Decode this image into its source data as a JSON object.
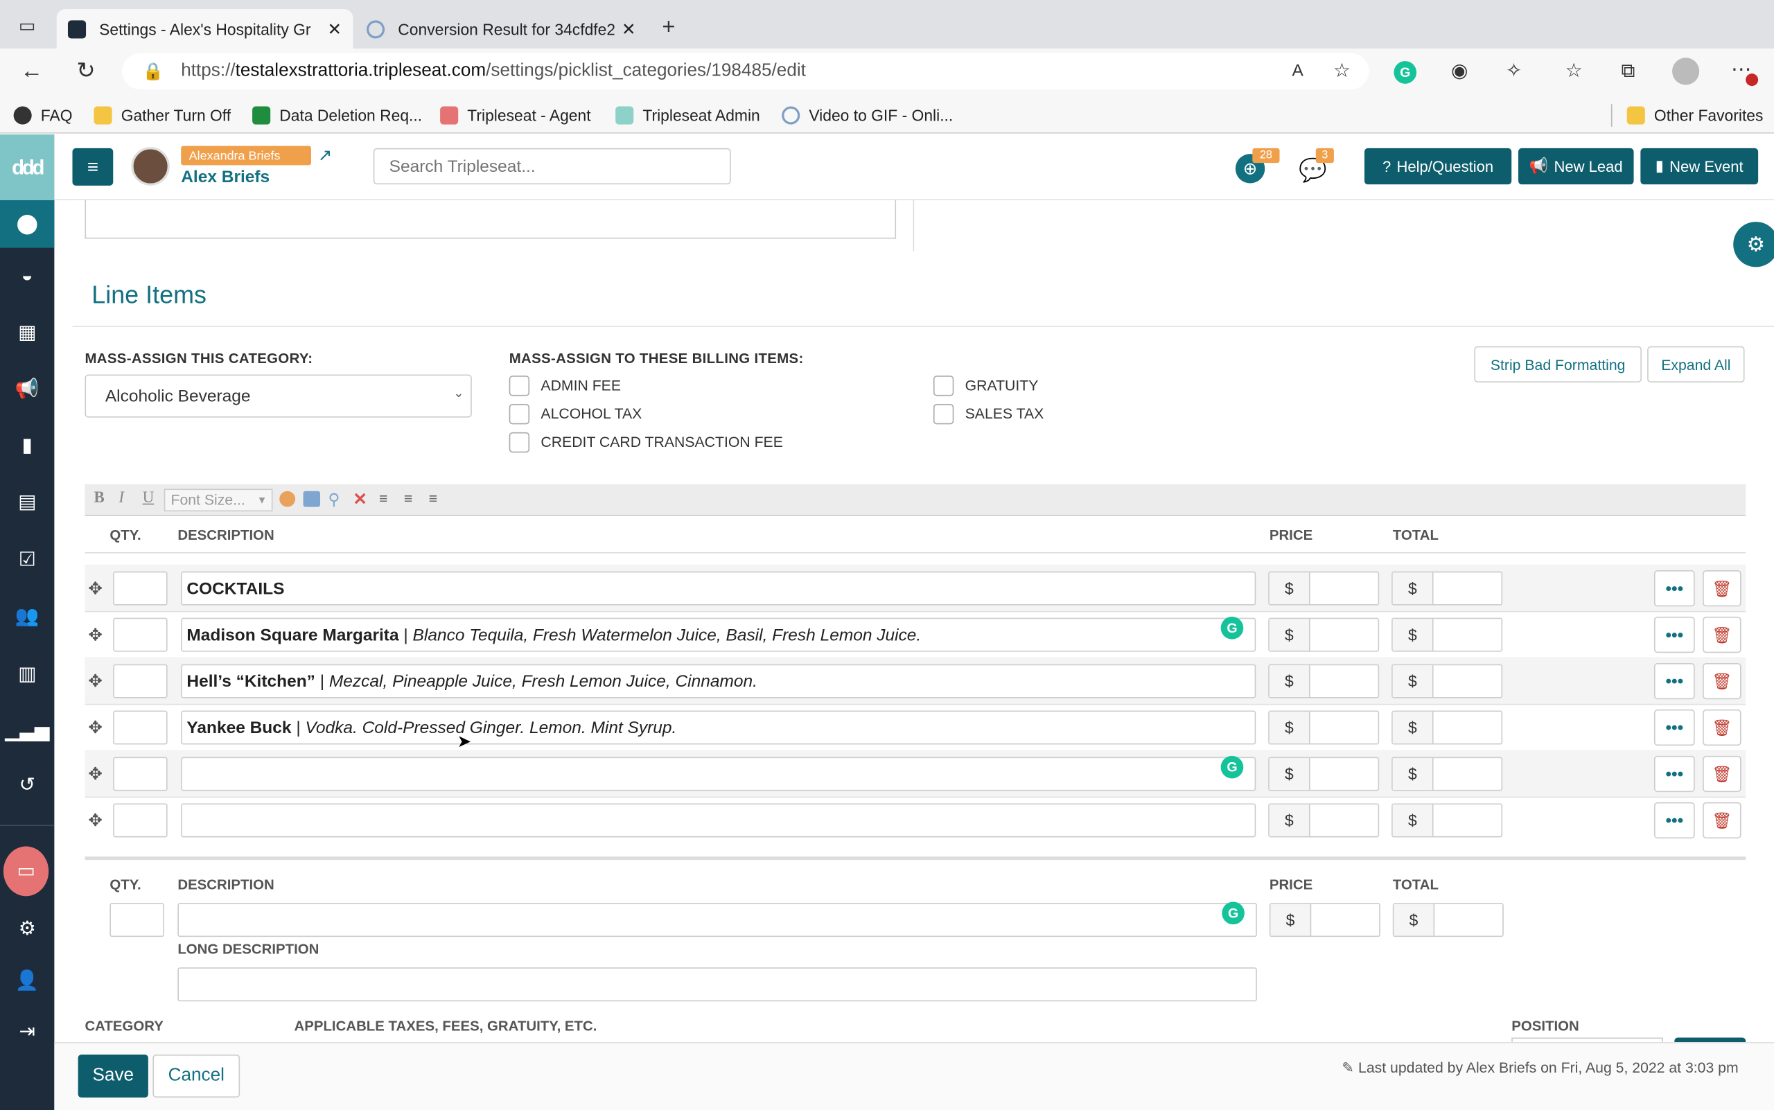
{
  "browser": {
    "tabs": [
      {
        "title": "Settings - Alex's Hospitality Gr",
        "active": true
      },
      {
        "title": "Conversion Result for 34cfdfe2",
        "active": false
      }
    ],
    "url_prefix": "https://",
    "url_domain": "testalexstrattoria.tripleseat.com",
    "url_path": "/settings/picklist_categories/198485/edit",
    "bookmarks": [
      "FAQ",
      "Gather Turn Off",
      "Data Deletion Req...",
      "Tripleseat - Agent",
      "Tripleseat Admin",
      "Video to GIF - Onli..."
    ],
    "other_favorites": "Other Favorites"
  },
  "header": {
    "user_badge": "Alexandra Briefs",
    "user_name": "Alex Briefs",
    "search_placeholder": "Search Tripleseat...",
    "notif_count": "28",
    "msg_count": "3",
    "help_label": "Help/Question",
    "new_lead_label": "New Lead",
    "new_event_label": "New Event"
  },
  "line_items": {
    "title": "Line Items",
    "mass_category_label": "MASS-ASSIGN THIS CATEGORY:",
    "category_value": "Alcoholic Beverage",
    "mass_billing_label": "MASS-ASSIGN TO THESE BILLING ITEMS:",
    "billing_items": [
      "ADMIN FEE",
      "ALCOHOL TAX",
      "CREDIT CARD TRANSACTION FEE",
      "GRATUITY",
      "SALES TAX"
    ],
    "strip_label": "Strip Bad Formatting",
    "expand_label": "Expand All",
    "font_size_placeholder": "Font Size...",
    "col_qty": "QTY.",
    "col_desc": "DESCRIPTION",
    "col_price": "PRICE",
    "col_total": "TOTAL",
    "currency": "$",
    "rows": [
      {
        "bold": "COCKTAILS",
        "sep": "",
        "italic": ""
      },
      {
        "bold": "Madison Square Margarita",
        "sep": " | ",
        "italic": "Blanco Tequila, Fresh Watermelon Juice, Basil, Fresh Lemon Juice."
      },
      {
        "bold": "Hell’s “Kitchen”",
        "sep": " | ",
        "italic": "Mezcal, Pineapple Juice, Fresh Lemon Juice, Cinnamon."
      },
      {
        "bold": "Yankee Buck",
        "sep": " | ",
        "italic": "Vodka. Cold-Pressed Ginger. Lemon. Mint Syrup."
      },
      {
        "bold": "",
        "sep": "",
        "italic": ""
      },
      {
        "bold": "",
        "sep": "",
        "italic": ""
      }
    ],
    "new_item": {
      "col_qty": "QTY.",
      "col_desc": "DESCRIPTION",
      "col_price": "PRICE",
      "col_total": "TOTAL",
      "long_desc_label": "LONG DESCRIPTION",
      "category_label": "CATEGORY",
      "taxes_label": "APPLICABLE TAXES, FEES, GRATUITY, ETC.",
      "position_label": "POSITION"
    }
  },
  "footer": {
    "save_label": "Save",
    "cancel_label": "Cancel",
    "last_updated": "Last updated by Alex Briefs on Fri, Aug 5, 2022 at 3:03 pm"
  },
  "colors": {
    "teal": "#0d5d6c",
    "accent": "#127081",
    "nav": "#1d2b3a",
    "badge": "#f0a04b",
    "delete": "#c0392b"
  }
}
